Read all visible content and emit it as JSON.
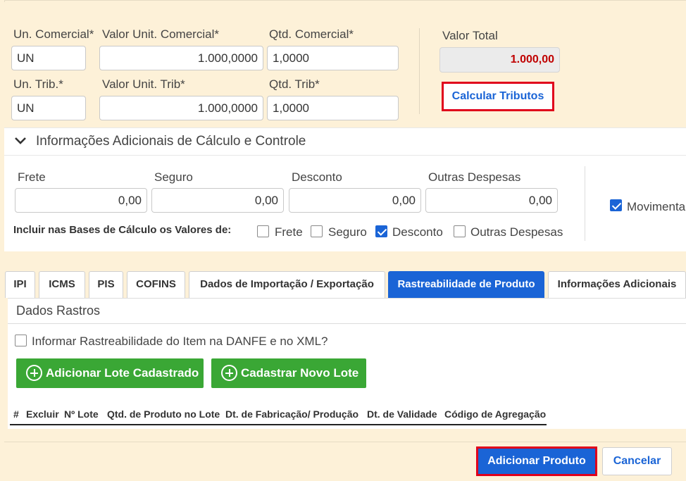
{
  "pricing": {
    "un_comercial_label": "Un. Comercial*",
    "valor_unit_comercial_label": "Valor Unit. Comercial*",
    "qtd_comercial_label": "Qtd. Comercial*",
    "un_comercial_value": "UN",
    "valor_unit_comercial_value": "1.000,0000",
    "qtd_comercial_value": "1,0000",
    "un_trib_label": "Un. Trib.*",
    "valor_unit_trib_label": "Valor Unit. Trib*",
    "qtd_trib_label": "Qtd. Trib*",
    "un_trib_value": "UN",
    "valor_unit_trib_value": "1.000,0000",
    "qtd_trib_value": "1,0000",
    "valor_total_label": "Valor Total",
    "valor_total_value": "1.000,00",
    "calcular_tributos_label": "Calcular Tributos"
  },
  "adicionais": {
    "title": "Informações Adicionais de Cálculo e Controle",
    "frete_label": "Frete",
    "frete_value": "0,00",
    "seguro_label": "Seguro",
    "seguro_value": "0,00",
    "desconto_label": "Desconto",
    "desconto_value": "0,00",
    "outras_label": "Outras Despesas",
    "outras_value": "0,00",
    "movimenta_label": "Movimenta",
    "movimenta_checked": true,
    "incluir_label": "Incluir nas Bases de Cálculo os Valores de:",
    "bases": [
      {
        "label": "Frete",
        "checked": false
      },
      {
        "label": "Seguro",
        "checked": false
      },
      {
        "label": "Desconto",
        "checked": true
      },
      {
        "label": "Outras Despesas",
        "checked": false
      }
    ]
  },
  "tabs": [
    {
      "label": "IPI",
      "active": false
    },
    {
      "label": "ICMS",
      "active": false
    },
    {
      "label": "PIS",
      "active": false
    },
    {
      "label": "COFINS",
      "active": false
    },
    {
      "label": "Dados de Importação / Exportação",
      "active": false
    },
    {
      "label": "Rastreabilidade de Produto",
      "active": true
    },
    {
      "label": "Informações Adicionais",
      "active": false
    }
  ],
  "rastros": {
    "title": "Dados Rastros",
    "informar_label": "Informar Rastreabilidade do Item na DANFE e no XML?",
    "informar_checked": false,
    "add_lote_label": "Adicionar Lote Cadastrado",
    "novo_lote_label": "Cadastrar Novo Lote",
    "columns": [
      "#",
      "Excluir",
      "Nº Lote",
      "Qtd. de Produto no Lote",
      "Dt. de Fabricação/ Produção",
      "Dt. de Validade",
      "Código de Agregação"
    ]
  },
  "footer": {
    "adicionar_label": "Adicionar Produto",
    "cancelar_label": "Cancelar"
  },
  "colors": {
    "accent": "#1a64d6",
    "highlight": "#e0001b",
    "green": "#3aa735",
    "background": "#fdf1d8",
    "total": "#c00000"
  }
}
